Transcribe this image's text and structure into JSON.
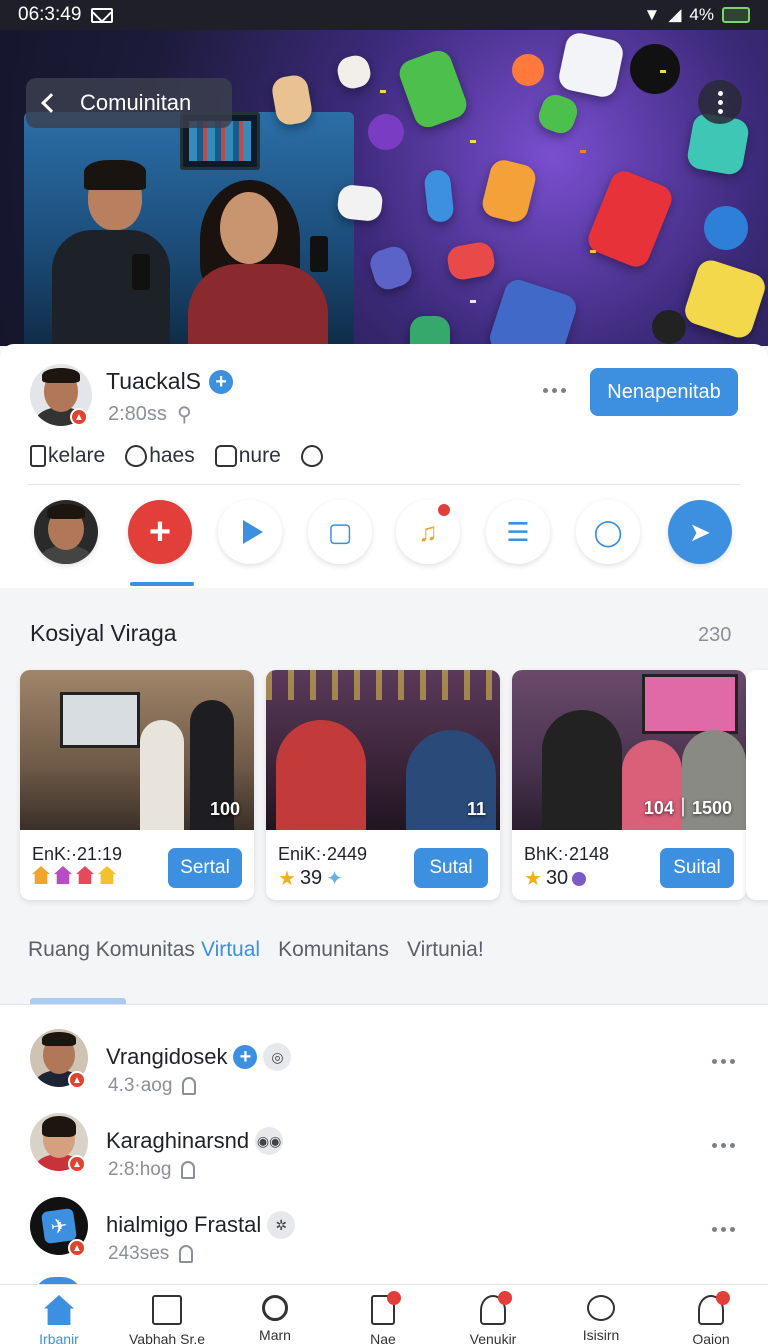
{
  "status_bar": {
    "time": "06:3:49",
    "battery": "4%"
  },
  "header": {
    "title": "Comuinitan"
  },
  "profile": {
    "name": "TuackalS",
    "time": "2:80ss",
    "join_label": "Nenapenitab",
    "actions": [
      {
        "icon": "bookmark-icon",
        "label": "kelare"
      },
      {
        "icon": "heart-icon",
        "label": "haes"
      },
      {
        "icon": "share-icon",
        "label": "nure"
      },
      {
        "icon": "heart-icon",
        "label": ""
      }
    ],
    "circles": [
      {
        "icon": "avatar"
      },
      {
        "icon": "plus-icon"
      },
      {
        "icon": "play-icon"
      },
      {
        "icon": "tablet-icon"
      },
      {
        "icon": "music-icon"
      },
      {
        "icon": "document-icon"
      },
      {
        "icon": "person-icon"
      },
      {
        "icon": "send-icon"
      }
    ]
  },
  "section": {
    "title": "Kosiyal Viraga",
    "count": "230",
    "tiles": [
      {
        "count": "100",
        "label": "EnK:·21:19",
        "button": "Sertal",
        "colors": [
          "#f2a42c",
          "#b74cc4",
          "#e6495b",
          "#f2c12c"
        ]
      },
      {
        "count": "11",
        "label": "EniK:·2449",
        "sub": "39",
        "button": "Sutal"
      },
      {
        "count": "104｜1500",
        "label": "BhK:·2148",
        "sub": "30",
        "button": "Suital"
      }
    ],
    "tabs": [
      "Ruang Komunitas",
      "Virtual",
      "Komunitans",
      "Virtunia!"
    ]
  },
  "members": [
    {
      "name": "Vrangidosek",
      "time": "4.3·aog"
    },
    {
      "name": "Karaghinarsnd",
      "time": "2:8:hog"
    },
    {
      "name": "hialmigo Frastal",
      "time": "243ses"
    }
  ],
  "bottom_nav": [
    {
      "icon": "home-icon",
      "label": "Irbanir",
      "active": true
    },
    {
      "icon": "grid-icon",
      "label": "Vabhah Sr.e"
    },
    {
      "icon": "search-icon",
      "label": "Marn"
    },
    {
      "icon": "list-icon",
      "label": "Nae"
    },
    {
      "icon": "profile-icon",
      "label": "Venukir"
    },
    {
      "icon": "heart-icon",
      "label": "Isisirn"
    },
    {
      "icon": "person-icon",
      "label": "Oaion"
    }
  ],
  "colors": {
    "accent": "#3d8fe0",
    "danger": "#e23f3a"
  }
}
